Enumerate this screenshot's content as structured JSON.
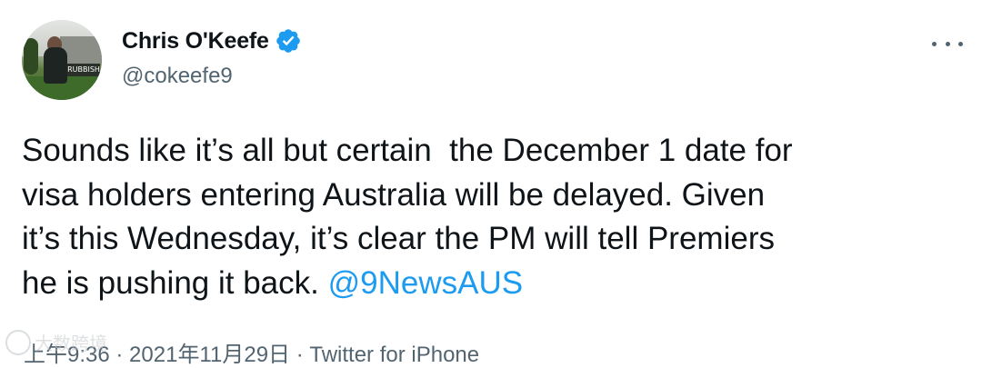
{
  "author": {
    "display_name": "Chris O'Keefe",
    "handle": "@cokeefe9",
    "verified": true,
    "avatar_sign_text": "RUBBISH"
  },
  "menu": {
    "icon": "more-horizontal-icon"
  },
  "tweet": {
    "text_lines": [
      "Sounds like it’s all but certain  the December 1 date for",
      "visa holders entering Australia will be delayed. Given",
      "it’s this Wednesday, it’s clear the PM will tell Premiers",
      "he is pushing it back. "
    ],
    "mention": "@9NewsAUS"
  },
  "meta": {
    "time": "上午9:36",
    "separator": " · ",
    "date": "2021年11月29日",
    "source": "Twitter for iPhone"
  },
  "watermark": {
    "text": "大数跨境"
  },
  "colors": {
    "text": "#0f1419",
    "secondary": "#536471",
    "accent": "#1d9bf0"
  }
}
